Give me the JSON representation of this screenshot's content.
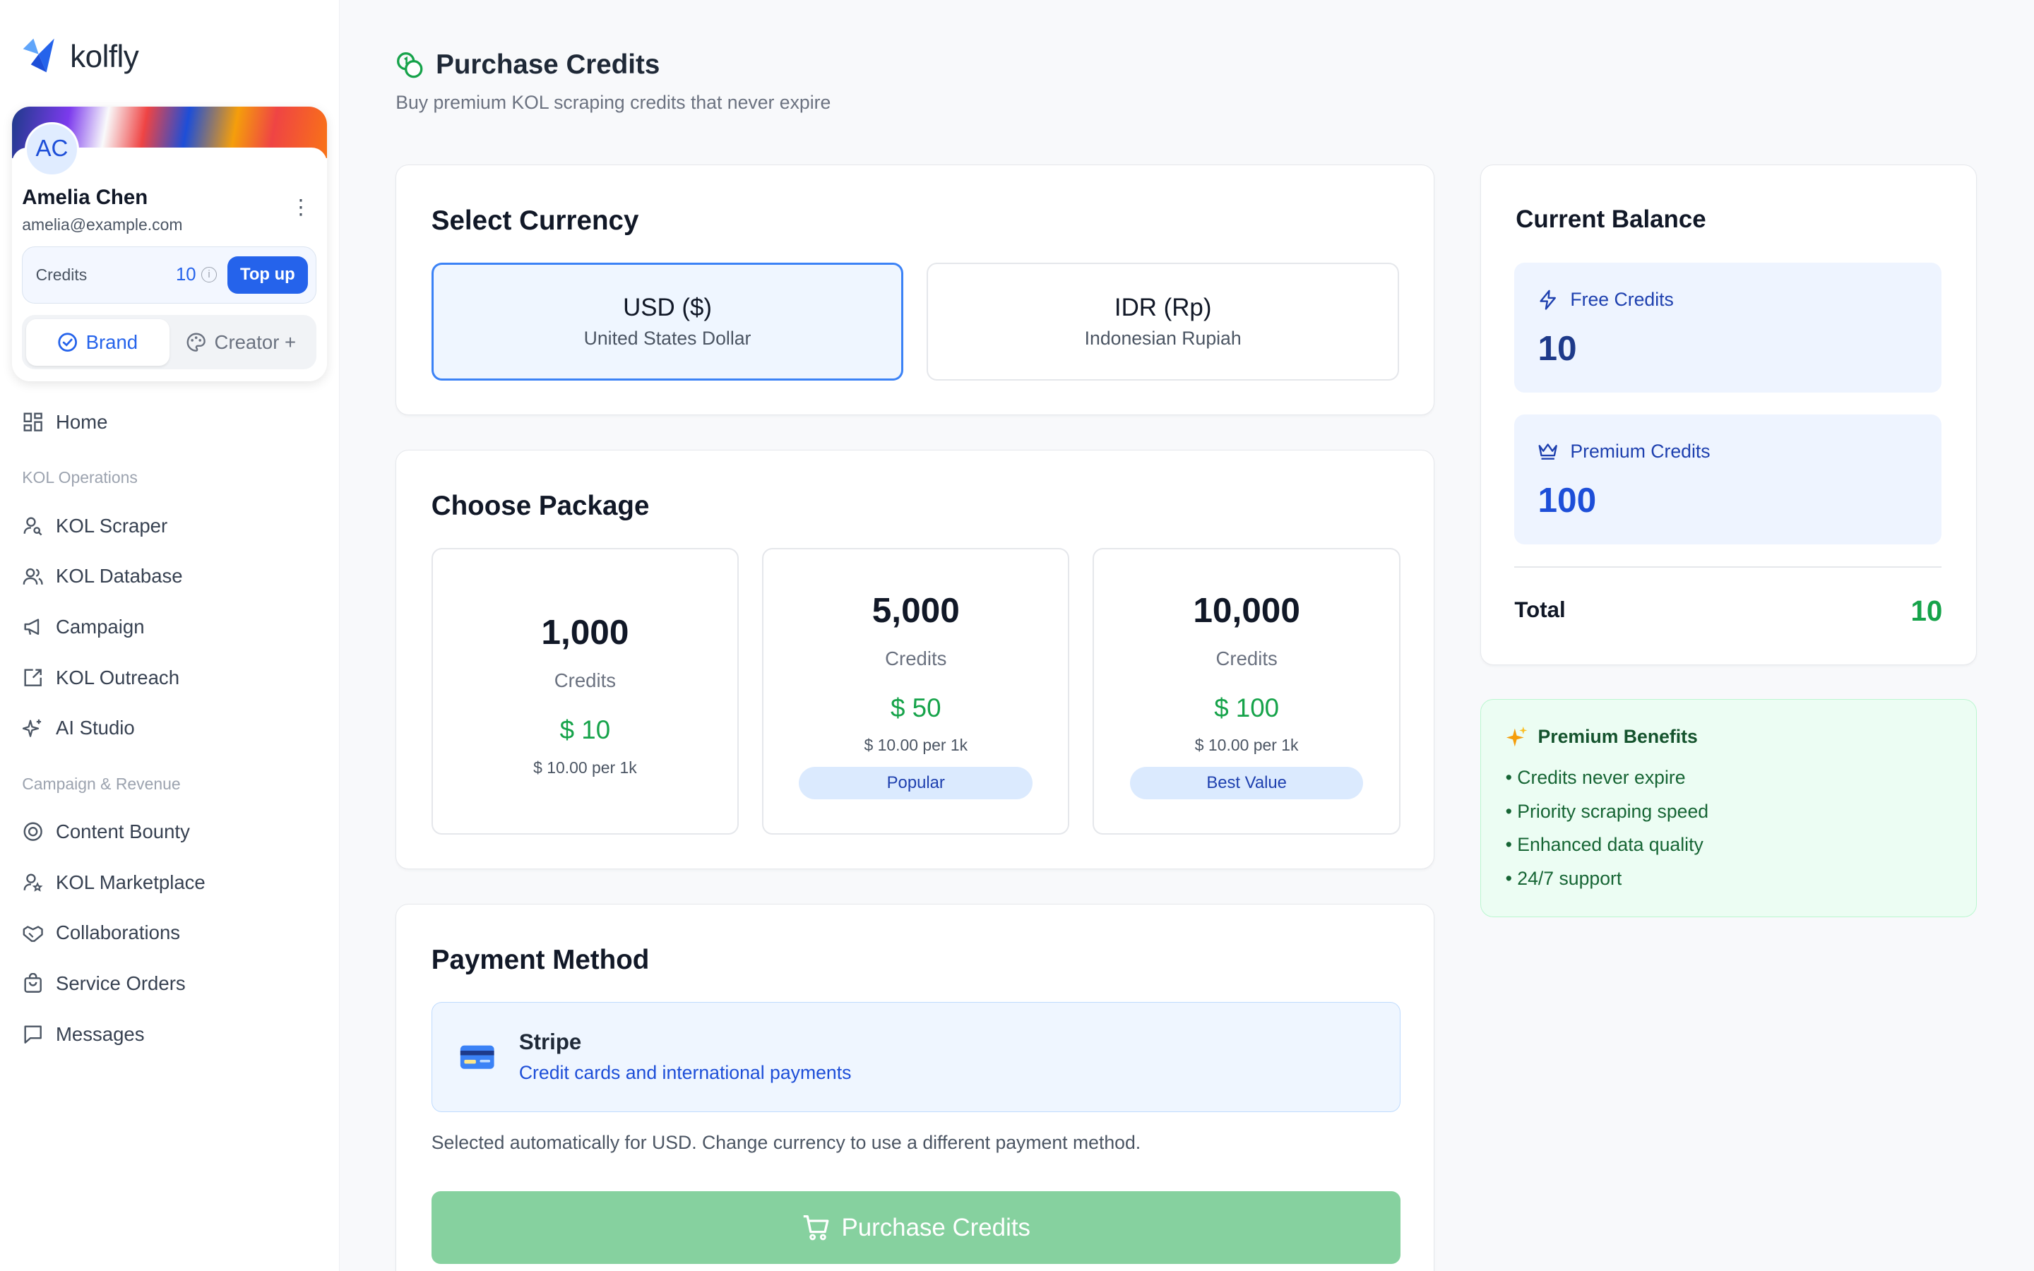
{
  "app": {
    "logo_text": "kolfly",
    "accent": "#2563eb",
    "success": "#16a34a"
  },
  "sidebar": {
    "profile": {
      "initials": "AC",
      "name": "Amelia Chen",
      "email": "amelia@example.com",
      "credits_label": "Credits",
      "credits_value": "10",
      "topup_label": "Top up"
    },
    "mode_toggle": {
      "brand_label": "Brand",
      "creator_label": "Creator +",
      "selected": "Brand"
    },
    "items": [
      {
        "label": "Home",
        "icon": "grid-icon"
      },
      {
        "label": "KOL Scraper",
        "icon": "user-search-icon"
      },
      {
        "label": "KOL Database",
        "icon": "users-icon"
      },
      {
        "label": "Campaign",
        "icon": "megaphone-icon"
      },
      {
        "label": "KOL Outreach",
        "icon": "outreach-icon"
      },
      {
        "label": "AI Studio",
        "icon": "sparkles-icon"
      },
      {
        "label": "Content Bounty",
        "icon": "badge-icon"
      },
      {
        "label": "KOL Marketplace",
        "icon": "user-star-icon"
      },
      {
        "label": "Collaborations",
        "icon": "handshake-icon"
      },
      {
        "label": "Service Orders",
        "icon": "bag-icon"
      },
      {
        "label": "Messages",
        "icon": "message-icon"
      }
    ],
    "sections": {
      "kol_operations": "KOL Operations",
      "campaign_revenue": "Campaign & Revenue"
    }
  },
  "page": {
    "title": "Purchase Credits",
    "subtitle": "Buy premium KOL scraping credits that never expire"
  },
  "currency": {
    "title": "Select Currency",
    "options": [
      {
        "code": "USD ($)",
        "name": "United States Dollar",
        "selected": true
      },
      {
        "code": "IDR (Rp)",
        "name": "Indonesian Rupiah",
        "selected": false
      }
    ]
  },
  "packages": {
    "title": "Choose Package",
    "items": [
      {
        "amount": "1,000",
        "unit": "Credits",
        "price": "$ 10",
        "per": "$ 10.00 per 1k",
        "badge": ""
      },
      {
        "amount": "5,000",
        "unit": "Credits",
        "price": "$ 50",
        "per": "$ 10.00 per 1k",
        "badge": "Popular"
      },
      {
        "amount": "10,000",
        "unit": "Credits",
        "price": "$ 100",
        "per": "$ 10.00 per 1k",
        "badge": "Best Value"
      }
    ]
  },
  "payment": {
    "title": "Payment Method",
    "method_name": "Stripe",
    "method_desc": "Credit cards and international payments",
    "note": "Selected automatically for USD. Change currency to use a different payment method.",
    "purchase_label": "Purchase Credits"
  },
  "balance": {
    "title": "Current Balance",
    "free_label": "Free Credits",
    "free_value": "10",
    "premium_label": "Premium Credits",
    "premium_value": "100",
    "total_label": "Total",
    "total_value": "10"
  },
  "benefits": {
    "title": "Premium Benefits",
    "items": [
      "• Credits never expire",
      "• Priority scraping speed",
      "• Enhanced data quality",
      "• 24/7 support"
    ]
  }
}
